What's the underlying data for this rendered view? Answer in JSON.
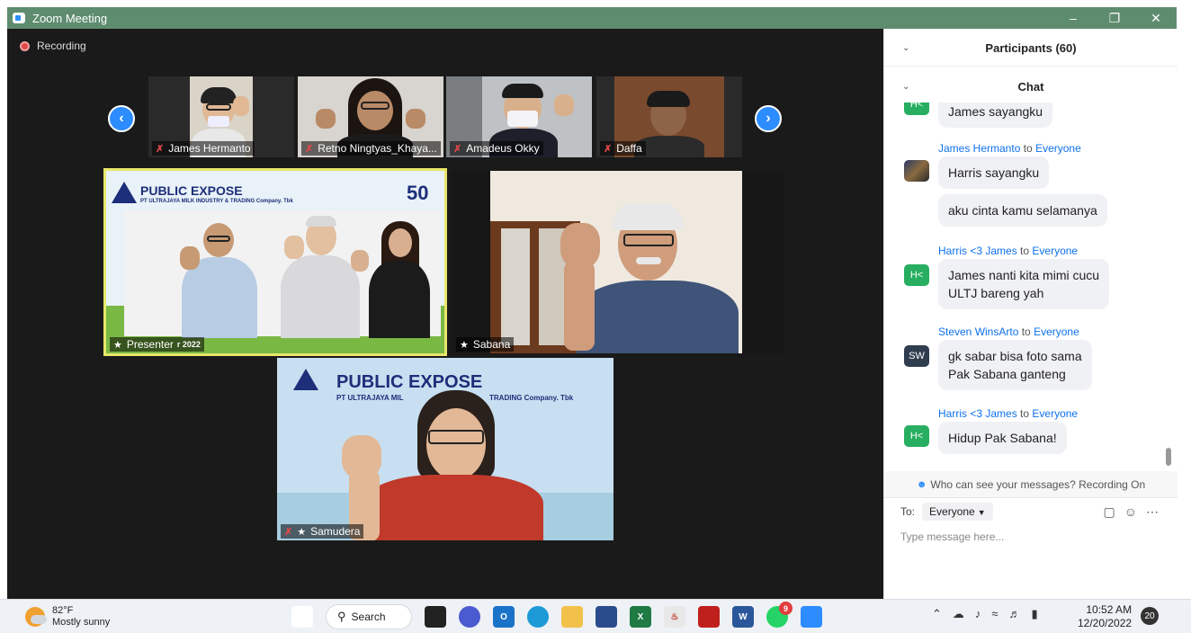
{
  "window": {
    "title": "Zoom Meeting",
    "min_icon": "minimize-icon",
    "restore_icon": "restore-icon",
    "close_icon": "close-icon"
  },
  "meeting": {
    "recording_label": "Recording",
    "gallery": [
      {
        "name": "James Hermanto"
      },
      {
        "name": "Retno Ningtyas_Khaya..."
      },
      {
        "name": "Amadeus Okky"
      },
      {
        "name": "Daffa"
      }
    ],
    "presenter_label": "Presenter",
    "presenter_slide_year": "r 2022",
    "expose_title": "PUBLIC EXPOSE",
    "expose_subtitle": "PT ULTRAJAYA MILK INDUSTRY & TRADING Company. Tbk",
    "expose_subtitle_partial_left": "PT ULTRAJAYA MIL",
    "expose_subtitle_partial_right": "TRADING Company. Tbk",
    "anniversary": "50",
    "sabana_name": "Sabana",
    "samudera_name": "Samudera"
  },
  "panel": {
    "participants_header": "Participants (60)",
    "chat_header": "Chat",
    "messages": [
      {
        "avatar": "H<",
        "avatar_color": "#27ae60",
        "bubbles": [
          "James sayangku"
        ]
      },
      {
        "sender": "James Hermanto",
        "to_word": "to",
        "recipient": "Everyone",
        "avatar": "",
        "bubbles": [
          "Harris sayangku",
          "aku cinta kamu selamanya"
        ]
      },
      {
        "sender": "Harris <3 James",
        "to_word": "to",
        "recipient": "Everyone",
        "avatar": "H<",
        "avatar_color": "#27ae60",
        "bubbles": [
          "James nanti kita mimi cucu",
          "ULTJ bareng yah"
        ]
      },
      {
        "sender": "Steven WinsArto",
        "to_word": "to",
        "recipient": "Everyone",
        "avatar": "SW",
        "avatar_color": "#2f3d4f",
        "bubbles": [
          "gk sabar bisa foto sama",
          "Pak Sabana ganteng"
        ]
      },
      {
        "sender": "Harris <3 James",
        "to_word": "to",
        "recipient": "Everyone",
        "avatar": "H<",
        "avatar_color": "#27ae60",
        "bubbles": [
          "Hidup Pak Sabana!"
        ]
      }
    ],
    "who_can_see": "Who can see your messages? Recording On",
    "to_label": "To:",
    "to_value": "Everyone",
    "placeholder": "Type message here..."
  },
  "taskbar": {
    "temp": "82°F",
    "condition": "Mostly sunny",
    "search_label": "Search",
    "whatsapp_badge": "9",
    "time": "10:52 AM",
    "date": "12/20/2022",
    "notification_count": "20"
  }
}
